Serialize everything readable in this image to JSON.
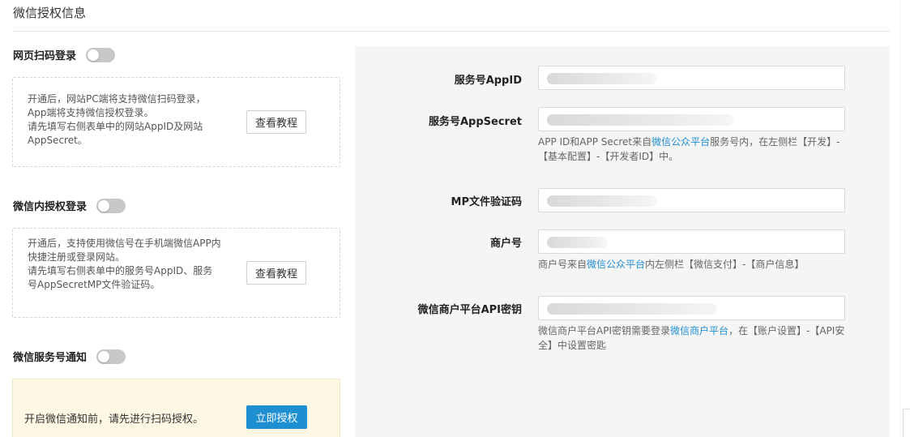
{
  "page": {
    "title": "微信授权信息"
  },
  "left": {
    "web_scan": {
      "label": "网页扫码登录",
      "enabled": false,
      "description": "开通后，网站PC端将支持微信扫码登录，\nApp端将支持微信授权登录。\n请先填写右侧表单中的网站AppID及网站\nAppSecret。",
      "tutorial_button": "查看教程"
    },
    "wechat_inapp": {
      "label": "微信内授权登录",
      "enabled": false,
      "description": "开通后，支持使用微信号在手机端微信APP内\n快捷注册或登录网站。\n请先填写右侧表单中的服务号AppID、服务\n号AppSecretMP文件验证码。",
      "tutorial_button": "查看教程"
    },
    "service_notify": {
      "label": "微信服务号通知",
      "enabled": false,
      "notice_text": "开启微信通知前，请先进行扫码授权。",
      "authorize_button": "立即授权"
    }
  },
  "form": {
    "appid": {
      "label": "服务号AppID"
    },
    "appsecret": {
      "label": "服务号AppSecret",
      "hint_pre": "APP ID和APP Secret来自",
      "hint_link": "微信公众平台",
      "hint_post": "服务号内，在左侧栏【开发】-【基本配置】-【开发者ID】中。"
    },
    "mp_code": {
      "label": "MP文件验证码"
    },
    "merchant_id": {
      "label": "商户号",
      "hint_pre": "商户号来自",
      "hint_link": "微信公众平台",
      "hint_post": "内左侧栏【微信支付】-【商户信息】"
    },
    "api_key": {
      "label": "微信商户平台API密钥",
      "hint_pre": "微信商户平台API密钥需要登录",
      "hint_link": "微信商户平台",
      "hint_post": "，在【账户设置】-【API安全】中设置密匙"
    }
  },
  "colors": {
    "accent": "#1e8fd1",
    "panel_bg": "#f5f5f5",
    "notice_bg": "#fdf7e3"
  }
}
